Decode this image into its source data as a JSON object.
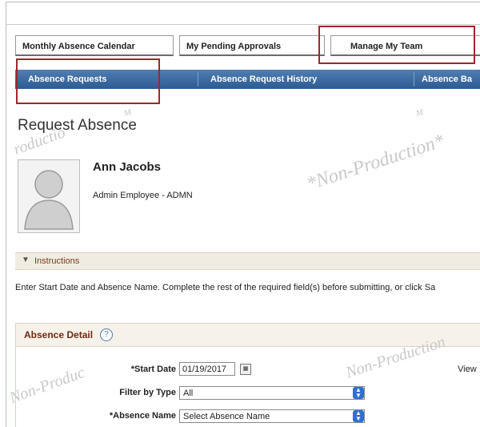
{
  "tabs": [
    {
      "label": "Monthly Absence Calendar"
    },
    {
      "label": "My Pending Approvals"
    },
    {
      "label": "Manage My Team"
    }
  ],
  "nav": [
    {
      "label": "Absence Requests"
    },
    {
      "label": "Absence Request History"
    },
    {
      "label": "Absence Ba"
    }
  ],
  "page": {
    "title": "Request Absence"
  },
  "employee": {
    "name": "Ann Jacobs",
    "subtitle": "Admin Employee - ADMN"
  },
  "instructions": {
    "label": "Instructions",
    "text": "Enter Start Date and Absence Name. Complete the rest of the required field(s) before submitting, or click Sa"
  },
  "detail": {
    "title": "Absence Detail",
    "help_icon": "?",
    "start_date_label": "*Start Date",
    "start_date_value": "01/19/2017",
    "filter_label": "Filter by Type",
    "filter_value": "All",
    "absence_name_label": "*Absence Name",
    "absence_name_value": "Select Absence Name",
    "view_link": "View"
  },
  "watermark": {
    "text": "*Non-Production*",
    "text_short": "Non-Production",
    "text_partial": "roductio",
    "text_left": "Non-Produc",
    "text_mark": "M"
  },
  "colors": {
    "nav_bar": "#3a6aa0",
    "highlight": "#a0262b",
    "section_title": "#6e2a10"
  }
}
